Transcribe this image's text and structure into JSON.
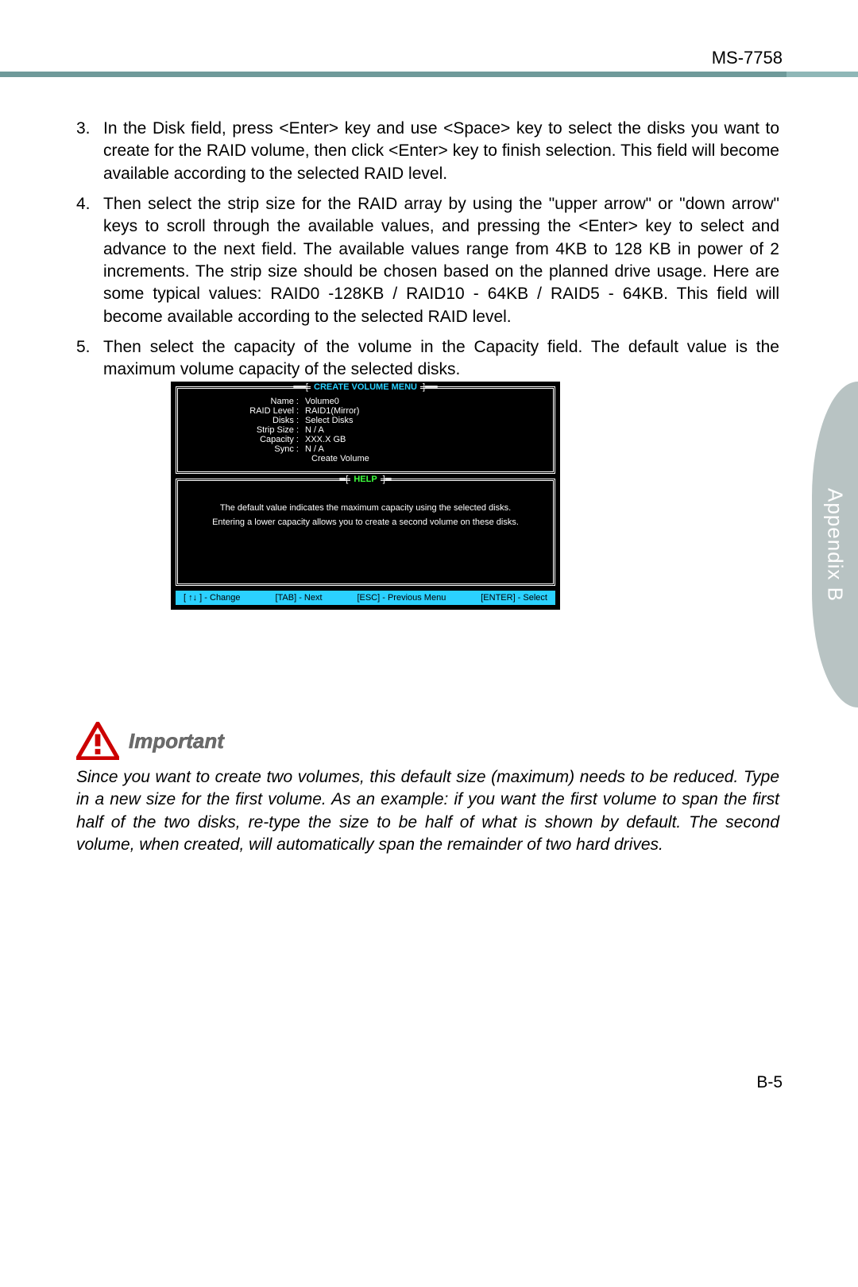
{
  "header": {
    "model": "MS-7758"
  },
  "steps": [
    {
      "n": "3.",
      "text": "In the Disk field, press <Enter> key and use <Space> key to select the disks you want to create for the RAID volume, then click <Enter> key to finish selection. This field will become available according to the selected RAID level."
    },
    {
      "n": "4.",
      "text": "Then select the strip size for the RAID array by using the \"upper arrow\" or \"down arrow\" keys to scroll through the available values, and pressing the <Enter> key to select and advance to the next field. The available values range from 4KB to 128 KB in power of 2 increments. The strip size should be chosen based on the planned drive usage. Here are some typical values: RAID0 -128KB / RAID10 - 64KB / RAID5 - 64KB. This field will become available according to the selected RAID level."
    },
    {
      "n": "5.",
      "text": "Then select the capacity of the volume in the Capacity field. The default value is the maximum volume capacity of the selected disks."
    }
  ],
  "bios": {
    "menu_title": "CREATE VOLUME MENU",
    "help_title": "HELP",
    "fields": {
      "name_label": "Name :",
      "name_value": "Volume0",
      "raid_label": "RAID Level :",
      "raid_value": "RAID1(Mirror)",
      "disks_label": "Disks :",
      "disks_value": "Select  Disks",
      "strip_label": "Strip Size :",
      "strip_value": "N / A",
      "cap_label": "Capacity :",
      "cap_value": "XXX.X  GB",
      "sync_label": "Sync :",
      "sync_value": "N / A",
      "create": "Create Volume"
    },
    "help_text": "The default value indicates the maximum capacity using the selected disks. Entering a lower capacity allows you to create a second volume on these disks.",
    "footer": {
      "change": "[ ↑↓ ] - Change",
      "tab": "[TAB] - Next",
      "esc": "[ESC] - Previous Menu",
      "enter": "[ENTER] - Select"
    }
  },
  "important": {
    "label": "Important",
    "text": "Since you want to create two volumes, this default size (maximum) needs to be reduced. Type in a new size for the first volume. As an example: if you want the first volume to span the first half of the two disks, re-type the size to be half of what is shown by default. The second volume, when created, will automatically span the remainder of two hard drives."
  },
  "side_tab": "Appendix B",
  "page_number": "B-5"
}
